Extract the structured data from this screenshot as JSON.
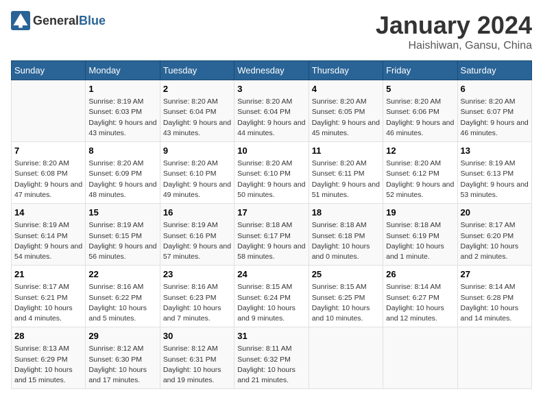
{
  "logo": {
    "general": "General",
    "blue": "Blue"
  },
  "title": "January 2024",
  "subtitle": "Haishiwan, Gansu, China",
  "days_header": [
    "Sunday",
    "Monday",
    "Tuesday",
    "Wednesday",
    "Thursday",
    "Friday",
    "Saturday"
  ],
  "weeks": [
    [
      {
        "day": "",
        "sunrise": "",
        "sunset": "",
        "daylight": ""
      },
      {
        "day": "1",
        "sunrise": "Sunrise: 8:19 AM",
        "sunset": "Sunset: 6:03 PM",
        "daylight": "Daylight: 9 hours and 43 minutes."
      },
      {
        "day": "2",
        "sunrise": "Sunrise: 8:20 AM",
        "sunset": "Sunset: 6:04 PM",
        "daylight": "Daylight: 9 hours and 43 minutes."
      },
      {
        "day": "3",
        "sunrise": "Sunrise: 8:20 AM",
        "sunset": "Sunset: 6:04 PM",
        "daylight": "Daylight: 9 hours and 44 minutes."
      },
      {
        "day": "4",
        "sunrise": "Sunrise: 8:20 AM",
        "sunset": "Sunset: 6:05 PM",
        "daylight": "Daylight: 9 hours and 45 minutes."
      },
      {
        "day": "5",
        "sunrise": "Sunrise: 8:20 AM",
        "sunset": "Sunset: 6:06 PM",
        "daylight": "Daylight: 9 hours and 46 minutes."
      },
      {
        "day": "6",
        "sunrise": "Sunrise: 8:20 AM",
        "sunset": "Sunset: 6:07 PM",
        "daylight": "Daylight: 9 hours and 46 minutes."
      }
    ],
    [
      {
        "day": "7",
        "sunrise": "Sunrise: 8:20 AM",
        "sunset": "Sunset: 6:08 PM",
        "daylight": "Daylight: 9 hours and 47 minutes."
      },
      {
        "day": "8",
        "sunrise": "Sunrise: 8:20 AM",
        "sunset": "Sunset: 6:09 PM",
        "daylight": "Daylight: 9 hours and 48 minutes."
      },
      {
        "day": "9",
        "sunrise": "Sunrise: 8:20 AM",
        "sunset": "Sunset: 6:10 PM",
        "daylight": "Daylight: 9 hours and 49 minutes."
      },
      {
        "day": "10",
        "sunrise": "Sunrise: 8:20 AM",
        "sunset": "Sunset: 6:10 PM",
        "daylight": "Daylight: 9 hours and 50 minutes."
      },
      {
        "day": "11",
        "sunrise": "Sunrise: 8:20 AM",
        "sunset": "Sunset: 6:11 PM",
        "daylight": "Daylight: 9 hours and 51 minutes."
      },
      {
        "day": "12",
        "sunrise": "Sunrise: 8:20 AM",
        "sunset": "Sunset: 6:12 PM",
        "daylight": "Daylight: 9 hours and 52 minutes."
      },
      {
        "day": "13",
        "sunrise": "Sunrise: 8:19 AM",
        "sunset": "Sunset: 6:13 PM",
        "daylight": "Daylight: 9 hours and 53 minutes."
      }
    ],
    [
      {
        "day": "14",
        "sunrise": "Sunrise: 8:19 AM",
        "sunset": "Sunset: 6:14 PM",
        "daylight": "Daylight: 9 hours and 54 minutes."
      },
      {
        "day": "15",
        "sunrise": "Sunrise: 8:19 AM",
        "sunset": "Sunset: 6:15 PM",
        "daylight": "Daylight: 9 hours and 56 minutes."
      },
      {
        "day": "16",
        "sunrise": "Sunrise: 8:19 AM",
        "sunset": "Sunset: 6:16 PM",
        "daylight": "Daylight: 9 hours and 57 minutes."
      },
      {
        "day": "17",
        "sunrise": "Sunrise: 8:18 AM",
        "sunset": "Sunset: 6:17 PM",
        "daylight": "Daylight: 9 hours and 58 minutes."
      },
      {
        "day": "18",
        "sunrise": "Sunrise: 8:18 AM",
        "sunset": "Sunset: 6:18 PM",
        "daylight": "Daylight: 10 hours and 0 minutes."
      },
      {
        "day": "19",
        "sunrise": "Sunrise: 8:18 AM",
        "sunset": "Sunset: 6:19 PM",
        "daylight": "Daylight: 10 hours and 1 minute."
      },
      {
        "day": "20",
        "sunrise": "Sunrise: 8:17 AM",
        "sunset": "Sunset: 6:20 PM",
        "daylight": "Daylight: 10 hours and 2 minutes."
      }
    ],
    [
      {
        "day": "21",
        "sunrise": "Sunrise: 8:17 AM",
        "sunset": "Sunset: 6:21 PM",
        "daylight": "Daylight: 10 hours and 4 minutes."
      },
      {
        "day": "22",
        "sunrise": "Sunrise: 8:16 AM",
        "sunset": "Sunset: 6:22 PM",
        "daylight": "Daylight: 10 hours and 5 minutes."
      },
      {
        "day": "23",
        "sunrise": "Sunrise: 8:16 AM",
        "sunset": "Sunset: 6:23 PM",
        "daylight": "Daylight: 10 hours and 7 minutes."
      },
      {
        "day": "24",
        "sunrise": "Sunrise: 8:15 AM",
        "sunset": "Sunset: 6:24 PM",
        "daylight": "Daylight: 10 hours and 9 minutes."
      },
      {
        "day": "25",
        "sunrise": "Sunrise: 8:15 AM",
        "sunset": "Sunset: 6:25 PM",
        "daylight": "Daylight: 10 hours and 10 minutes."
      },
      {
        "day": "26",
        "sunrise": "Sunrise: 8:14 AM",
        "sunset": "Sunset: 6:27 PM",
        "daylight": "Daylight: 10 hours and 12 minutes."
      },
      {
        "day": "27",
        "sunrise": "Sunrise: 8:14 AM",
        "sunset": "Sunset: 6:28 PM",
        "daylight": "Daylight: 10 hours and 14 minutes."
      }
    ],
    [
      {
        "day": "28",
        "sunrise": "Sunrise: 8:13 AM",
        "sunset": "Sunset: 6:29 PM",
        "daylight": "Daylight: 10 hours and 15 minutes."
      },
      {
        "day": "29",
        "sunrise": "Sunrise: 8:12 AM",
        "sunset": "Sunset: 6:30 PM",
        "daylight": "Daylight: 10 hours and 17 minutes."
      },
      {
        "day": "30",
        "sunrise": "Sunrise: 8:12 AM",
        "sunset": "Sunset: 6:31 PM",
        "daylight": "Daylight: 10 hours and 19 minutes."
      },
      {
        "day": "31",
        "sunrise": "Sunrise: 8:11 AM",
        "sunset": "Sunset: 6:32 PM",
        "daylight": "Daylight: 10 hours and 21 minutes."
      },
      {
        "day": "",
        "sunrise": "",
        "sunset": "",
        "daylight": ""
      },
      {
        "day": "",
        "sunrise": "",
        "sunset": "",
        "daylight": ""
      },
      {
        "day": "",
        "sunrise": "",
        "sunset": "",
        "daylight": ""
      }
    ]
  ]
}
